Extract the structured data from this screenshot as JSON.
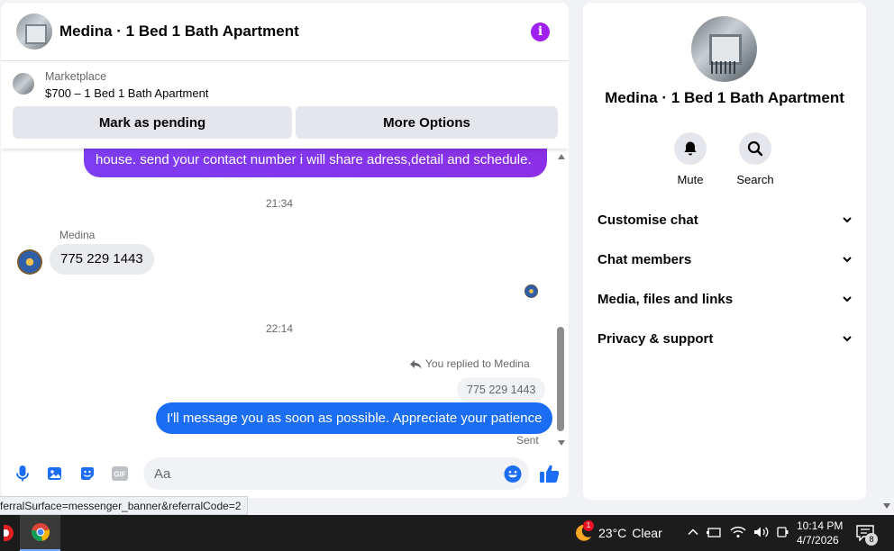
{
  "chat": {
    "title": "Medina · 1 Bed 1 Bath Apartment",
    "marketplace_label": "Marketplace",
    "listing": "$700 – 1 Bed 1 Bath Apartment",
    "mark_pending_label": "Mark as pending",
    "more_options_label": "More Options",
    "messages": {
      "previous_outgoing": "house. send your contact number i will share adress,detail and schedule.",
      "time1": "21:34",
      "sender_name": "Medina",
      "incoming": "775 229 1443",
      "time2": "22:14",
      "reply_note": "You replied to Medina",
      "reply_quote": "775 229 1443",
      "outgoing": "I'll message you as soon as possible. Appreciate your patience",
      "status": "Sent"
    },
    "composer": {
      "placeholder": "Aa",
      "gif_label": "GIF"
    }
  },
  "info": {
    "title": "Medina · 1 Bed 1 Bath Apartment",
    "mute_label": "Mute",
    "search_label": "Search",
    "sections": [
      "Customise chat",
      "Chat members",
      "Media, files and links",
      "Privacy & support"
    ]
  },
  "status_url": "ferralSurface=messenger_banner&referralCode=2",
  "taskbar": {
    "weather_temp": "23°C",
    "weather_desc": "Clear",
    "weather_badge": "1",
    "time": "10:14 PM",
    "date": "4/7/2026",
    "notification_count": "8"
  },
  "colors": {
    "messenger_blue": "#1b6ef3",
    "purple_bubble": "#8b2fe6",
    "info_purple": "#a020f0"
  }
}
